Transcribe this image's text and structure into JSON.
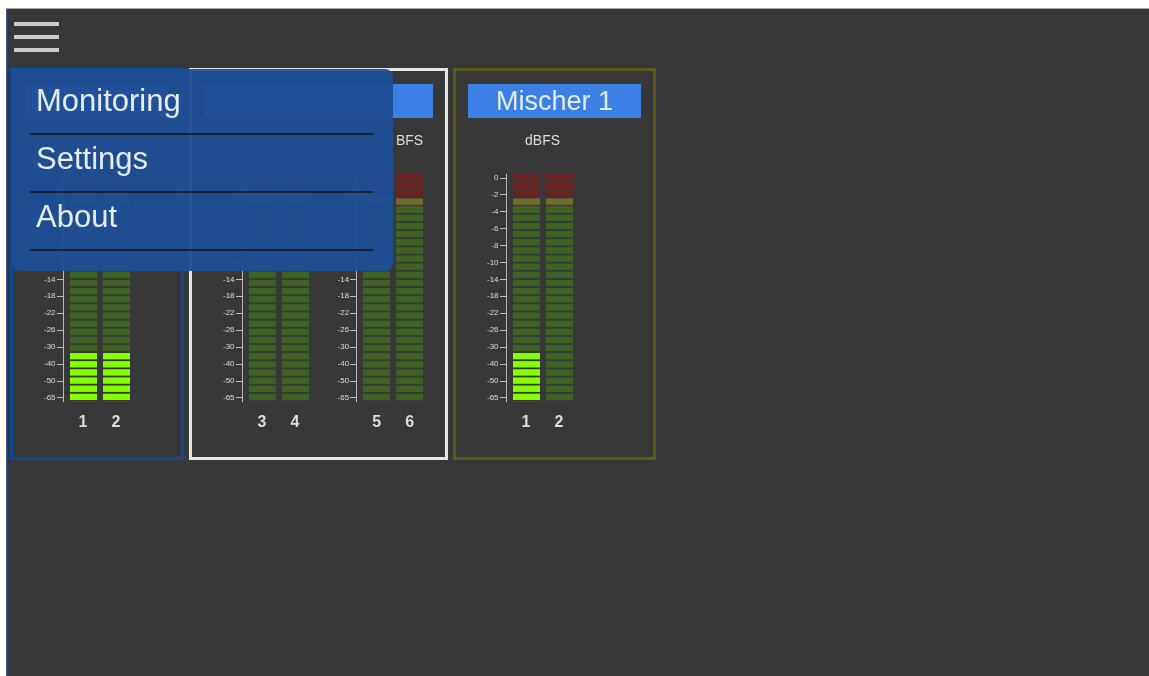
{
  "menu": {
    "open": true,
    "items": [
      {
        "label": "Monitoring"
      },
      {
        "label": "Settings"
      },
      {
        "label": "About"
      }
    ]
  },
  "panels": [
    {
      "color": "#0b4a9c",
      "groups": [
        {
          "scale": [
            "-14",
            "-18",
            "-22",
            "-26",
            "-30",
            "-40",
            "-50",
            "-65"
          ],
          "channels": [
            {
              "label": "1",
              "level": 0.214
            },
            {
              "label": "2",
              "level": 0.214
            }
          ]
        }
      ]
    },
    {
      "color": "#e6e6e6",
      "groups": [
        {
          "scale": [
            "-14",
            "-18",
            "-22",
            "-26",
            "-30",
            "-40",
            "-50",
            "-65"
          ],
          "channels": [
            {
              "label": "3",
              "level": 0
            },
            {
              "label": "4",
              "level": 0
            }
          ]
        },
        {
          "unit": "BFS",
          "scale": [
            "-14",
            "-18",
            "-22",
            "-26",
            "-30",
            "-40",
            "-50",
            "-65"
          ],
          "channels": [
            {
              "label": "5",
              "level": 0
            },
            {
              "label": "6",
              "level": 0
            }
          ]
        }
      ]
    },
    {
      "title": "Mischer 1",
      "color": "#5c5c14",
      "groups": [
        {
          "unit": "dBFS",
          "scale": [
            "0",
            "-2",
            "-4",
            "-6",
            "-8",
            "-10",
            "-14",
            "-18",
            "-22",
            "-26",
            "-30",
            "-40",
            "-50",
            "-65"
          ],
          "channels": [
            {
              "label": "1",
              "level": 0.214
            },
            {
              "label": "2",
              "level": 0
            }
          ]
        }
      ]
    }
  ]
}
